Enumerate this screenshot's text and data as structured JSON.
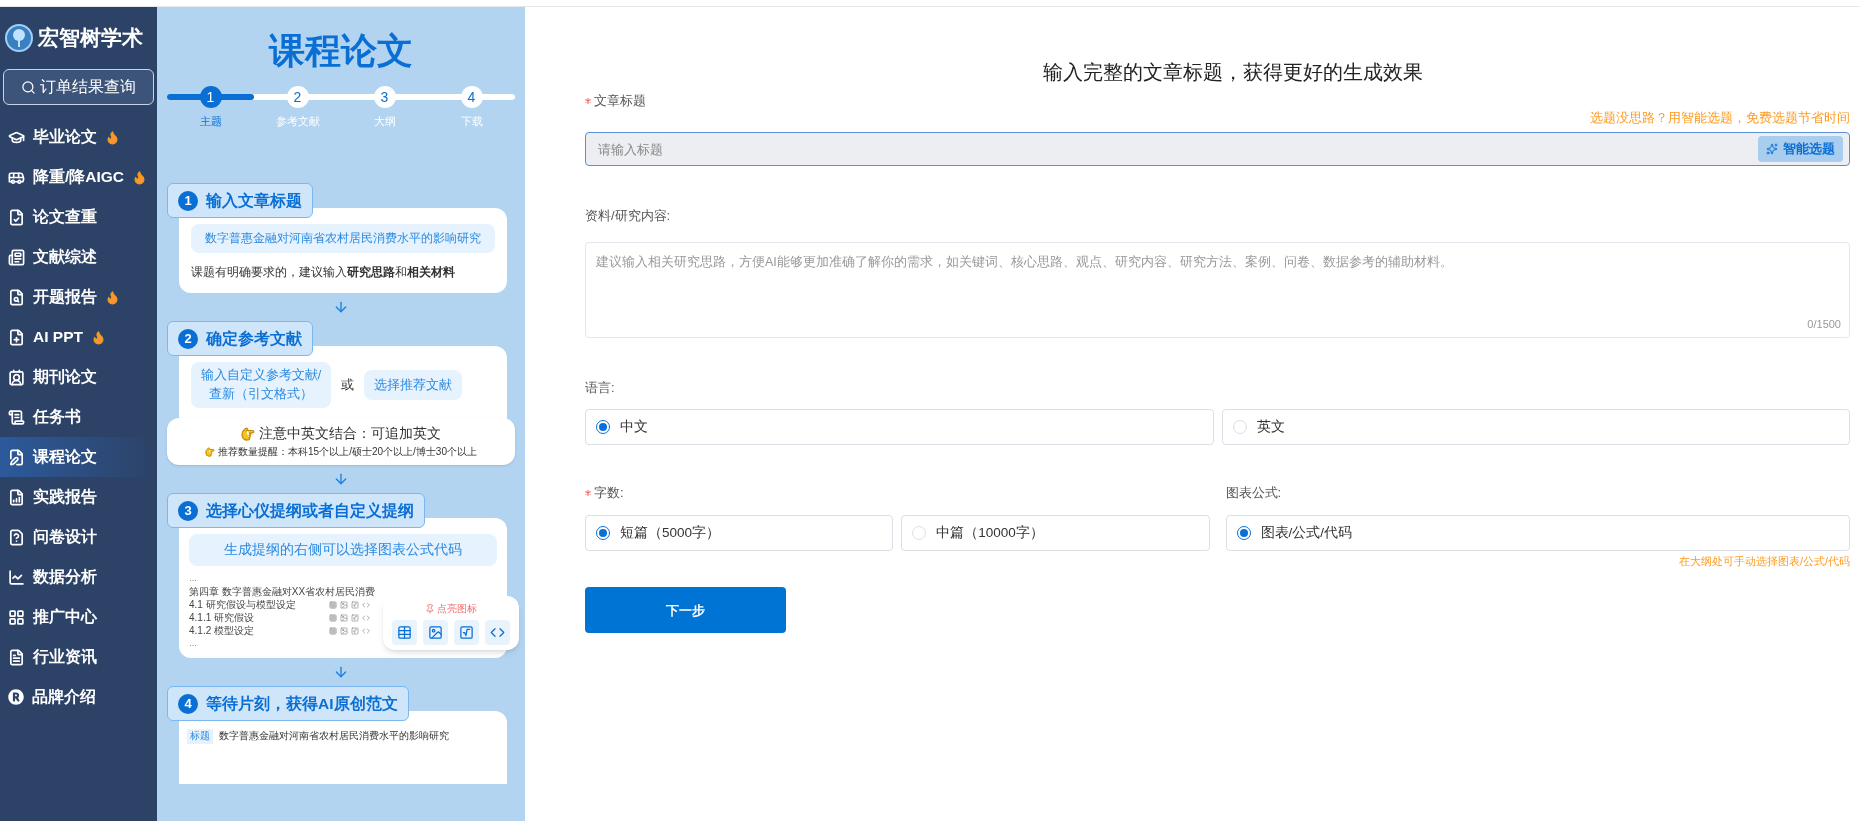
{
  "sidebar": {
    "brand": "宏智树学术",
    "order_button": "订单结果查询",
    "items": [
      {
        "label": "毕业论文",
        "hot": true,
        "selected": false
      },
      {
        "label": "降重/降AIGC",
        "hot": true,
        "selected": false
      },
      {
        "label": "论文查重",
        "hot": false,
        "selected": false
      },
      {
        "label": "文献综述",
        "hot": false,
        "selected": false
      },
      {
        "label": "开题报告",
        "hot": true,
        "selected": false
      },
      {
        "label": "AI PPT",
        "hot": true,
        "selected": false
      },
      {
        "label": "期刊论文",
        "hot": false,
        "selected": false
      },
      {
        "label": "任务书",
        "hot": false,
        "selected": false
      },
      {
        "label": "课程论文",
        "hot": false,
        "selected": true
      },
      {
        "label": "实践报告",
        "hot": false,
        "selected": false
      },
      {
        "label": "问卷设计",
        "hot": false,
        "selected": false
      },
      {
        "label": "数据分析",
        "hot": false,
        "selected": false
      },
      {
        "label": "推广中心",
        "hot": false,
        "selected": false
      },
      {
        "label": "行业资讯",
        "hot": false,
        "selected": false
      },
      {
        "label": "品牌介绍",
        "hot": false,
        "selected": false
      }
    ]
  },
  "guide": {
    "title": "课程论文",
    "steps": [
      {
        "number": "1",
        "label": "主题",
        "selected": true
      },
      {
        "number": "2",
        "label": "参考文献",
        "selected": false
      },
      {
        "number": "3",
        "label": "大纲",
        "selected": false
      },
      {
        "number": "4",
        "label": "下载",
        "selected": false
      }
    ],
    "card_1": {
      "number": "1",
      "title": "输入文章标题",
      "example": "数字普惠金融对河南省农村居民消费水平的影响研究",
      "note": "课题有明确要求的，建议输入**研究思路**和**相关材料**"
    },
    "card_2": {
      "number": "2",
      "title": "确定参考文献",
      "option_1": "输入自定义参考文献/查新（引文格式）",
      "or": "或",
      "option_2": "选择推荐文献",
      "tip_title": "注意中英文结合：可追加英文",
      "tip_note": "推荐数量提醒：本科15个以上/硕士20个以上/博士30个以上"
    },
    "card_3": {
      "number": "3",
      "title": "选择心仪提纲或者自定义提纲",
      "banner": "生成提纲的右侧可以选择图表公式代码",
      "outline": [
        {
          "text": "…",
          "kind": "gap"
        },
        {
          "text": "第四章 数字普惠金融对XX省农村居民消费",
          "kind": "chapter"
        },
        {
          "text": "4.1 研究假设与模型设定",
          "kind": "section"
        },
        {
          "text": "4.1.1 研究假设",
          "kind": "section"
        },
        {
          "text": "4.1.2 模型设定",
          "kind": "section"
        },
        {
          "text": "…",
          "kind": "gap"
        }
      ],
      "popup_title": "点亮图标"
    },
    "card_4": {
      "number": "4",
      "title": "等待片刻，获得AI原创范文",
      "tag": "标题",
      "text": "数字普惠金融对河南省农村居民消费水平的影响研究"
    }
  },
  "form": {
    "heading": "输入完整的文章标题，获得更好的生成效果",
    "title_field": {
      "label": "文章标题",
      "required": true,
      "hint": "选题没思路？用智能选题，免费选题节省时间",
      "placeholder": "请输入标题",
      "button": "智能选题"
    },
    "material": {
      "label": "资料/研究内容:",
      "placeholder": "建议输入相关研究思路，方便AI能够更加准确了解你的需求，如关键词、核心思路、观点、研究内容、研究方法、案例、问卷、数据参考的辅助材料。",
      "counter": "0/1500"
    },
    "language": {
      "label": "语言:",
      "options": [
        {
          "label": "中文",
          "selected": true
        },
        {
          "label": "英文",
          "selected": false
        }
      ]
    },
    "word_count": {
      "label": "字数:",
      "required": true,
      "options": [
        {
          "label": "短篇（5000字）",
          "selected": true
        },
        {
          "label": "中篇（10000字）",
          "selected": false
        }
      ]
    },
    "chart": {
      "label": "图表公式:",
      "options": [
        {
          "label": "图表/公式/代码",
          "selected": true
        }
      ],
      "note": "在大纲处可手动选择图表/公式/代码"
    },
    "next_button": "下一步"
  }
}
